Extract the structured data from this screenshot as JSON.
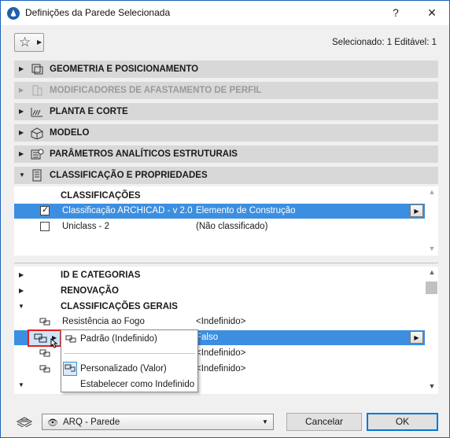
{
  "window": {
    "title": "Definições da Parede Selecionada",
    "help_label": "?",
    "close_label": "✕"
  },
  "header": {
    "selection_info": "Selecionado: 1 Editável: 1"
  },
  "panels": [
    {
      "label": "GEOMETRIA E POSICIONAMENTO",
      "icon": "geometry-icon",
      "enabled": true,
      "expanded": false
    },
    {
      "label": "MODIFICADORES DE AFASTAMENTO DE PERFIL",
      "icon": "profile-offset-icon",
      "enabled": false,
      "expanded": false
    },
    {
      "label": "PLANTA E CORTE",
      "icon": "floorplan-section-icon",
      "enabled": true,
      "expanded": false
    },
    {
      "label": "MODELO",
      "icon": "model-icon",
      "enabled": true,
      "expanded": false
    },
    {
      "label": "PARÂMETROS ANALÍTICOS ESTRUTURAIS",
      "icon": "structural-analytical-icon",
      "enabled": true,
      "expanded": false
    },
    {
      "label": "CLASSIFICAÇÃO E PROPRIEDADES",
      "icon": "classification-icon",
      "enabled": true,
      "expanded": true
    }
  ],
  "classifications": {
    "heading": "CLASSIFICAÇÕES",
    "rows": [
      {
        "checked": true,
        "system": "Classificação ARCHICAD - v 2.0",
        "value": "Elemento de Construção",
        "selected": true
      },
      {
        "checked": false,
        "system": "Uniclass - 2",
        "value": "(Não classificado)",
        "selected": false
      }
    ]
  },
  "properties": {
    "groups": [
      {
        "label": "ID E CATEGORIAS",
        "expanded": false
      },
      {
        "label": "RENOVAÇÃO",
        "expanded": false
      },
      {
        "label": "CLASSIFICAÇÕES GERAIS",
        "expanded": true
      }
    ],
    "rows": [
      {
        "name": "Resistência ao Fogo",
        "value": "<Indefinido>",
        "selected": false
      },
      {
        "name": "",
        "value": "Falso",
        "selected": true
      },
      {
        "name": "",
        "value": "<Indefinido>",
        "selected": false
      },
      {
        "name": "",
        "value": "<Indefinido>",
        "selected": false
      }
    ]
  },
  "popup_menu": {
    "items": [
      {
        "label": "Padrão (Indefinido)",
        "icon": "link-icon"
      },
      {
        "label": "Personalizado (Valor)",
        "icon": "custom-value-icon"
      },
      {
        "label": "Estabelecer como Indefinido",
        "icon": ""
      }
    ]
  },
  "footer": {
    "view_label": "ARQ - Parede",
    "cancel_label": "Cancelar",
    "ok_label": "OK"
  },
  "colors": {
    "selection": "#3c8fe0",
    "panel_bg": "#d8d8d8",
    "highlight_border": "#e02020"
  }
}
